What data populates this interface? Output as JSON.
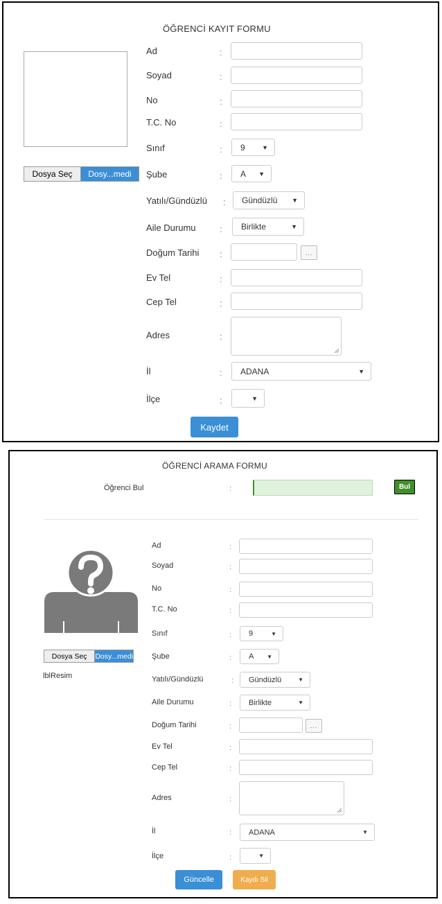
{
  "form1": {
    "title": "ÖĞRENCİ KAYIT FORMU",
    "colon": ":",
    "labels": {
      "ad": "Ad",
      "soyad": "Soyad",
      "no": "No",
      "tcno": "T.C. No",
      "sinif": "Sınıf",
      "sube": "Şube",
      "yatili": "Yatılı/Gündüzlü",
      "aile": "Aile Durumu",
      "dogum": "Doğum Tarihi",
      "evtel": "Ev Tel",
      "ceptel": "Cep Tel",
      "adres": "Adres",
      "il": "İl",
      "ilce": "İlçe"
    },
    "values": {
      "ad": "",
      "soyad": "",
      "no": "",
      "tcno": "",
      "dogum": "",
      "evtel": "",
      "ceptel": "",
      "adres": ""
    },
    "selects": {
      "sinif": "9",
      "sube": "A",
      "yatili": "Gündüzlü",
      "aile": "Birlikte",
      "il": "ADANA",
      "ilce": ""
    },
    "arrow": "▼",
    "date_button": "...",
    "file_choose": "Dosya Seç",
    "file_name": "Dosy...medi",
    "save_button": "Kaydet"
  },
  "form2": {
    "title": "ÖĞRENCİ ARAMA FORMU",
    "search_label": "Öğrenci Bul",
    "search_value": "",
    "search_button": "Bul",
    "colon": ":",
    "labels": {
      "ad": "Ad",
      "soyad": "Soyad",
      "no": "No",
      "tcno": "T.C. No",
      "sinif": "Sınıf",
      "sube": "Şube",
      "yatili": "Yatılı/Gündüzlü",
      "aile": "Aile Durumu",
      "dogum": "Doğum Tarihi",
      "evtel": "Ev Tel",
      "ceptel": "Cep Tel",
      "adres": "Adres",
      "il": "İl",
      "ilce": "İlçe"
    },
    "values": {
      "ad": "",
      "soyad": "",
      "no": "",
      "tcno": "",
      "dogum": "",
      "evtel": "",
      "ceptel": "",
      "adres": ""
    },
    "selects": {
      "sinif": "9",
      "sube": "A",
      "yatili": "Gündüzlü",
      "aile": "Birlikte",
      "il": "ADANA",
      "ilce": ""
    },
    "arrow": "▼",
    "date_button": "...",
    "file_choose": "Dosya Seç",
    "file_name": "Dosy...medi",
    "image_label": "lblResim",
    "avatar_icon": "unknown-person-icon",
    "update_button": "Güncelle",
    "delete_button": "Kaydı Sil"
  },
  "colors": {
    "blue_button": "#3a8fd6",
    "orange_button": "#f0ad4e",
    "green_button": "#3f8f2a",
    "search_bg": "#dff3dc"
  }
}
